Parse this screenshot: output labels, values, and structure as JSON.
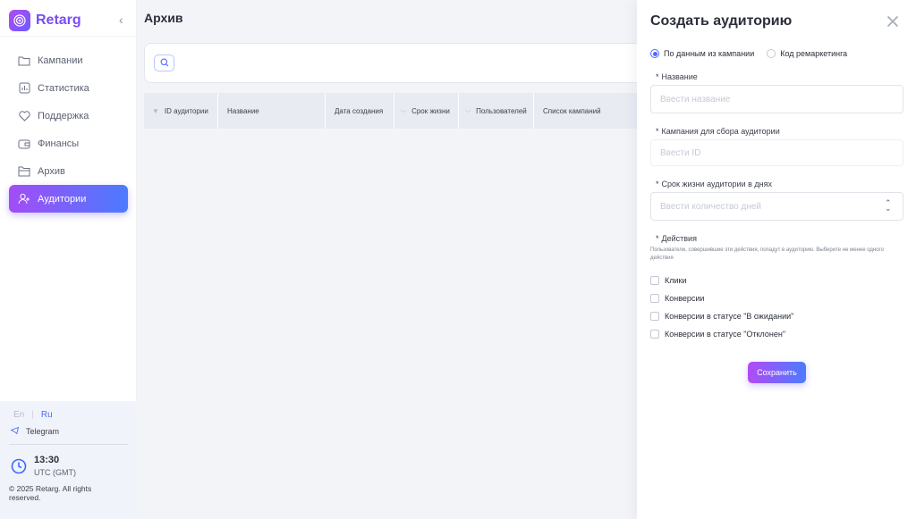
{
  "brand": {
    "name": "Retarg"
  },
  "sidebar": {
    "items": [
      {
        "label": "Кампании",
        "icon": "folder-icon"
      },
      {
        "label": "Статистика",
        "icon": "chart-icon"
      },
      {
        "label": "Поддержка",
        "icon": "heart-icon"
      },
      {
        "label": "Финансы",
        "icon": "wallet-icon"
      },
      {
        "label": "Архив",
        "icon": "archive-icon"
      },
      {
        "label": "Аудитории",
        "icon": "user-plus-icon",
        "active": true
      }
    ],
    "lang": {
      "en": "En",
      "separator": "|",
      "ru": "Ru",
      "active": "Ru"
    },
    "telegram": "Telegram",
    "clock": {
      "time": "13:30",
      "timezone": "UTC (GMT)"
    },
    "copyright": "© 2025 Retarg. All rights reserved."
  },
  "main": {
    "title": "Архив",
    "table": {
      "columns": [
        "ID аудитории",
        "Название",
        "Дата создания",
        "Срок жизни",
        "Пользователей",
        "Список кампаний"
      ]
    }
  },
  "drawer": {
    "title": "Создать аудиторию",
    "source_options": [
      {
        "label": "По данным из кампании",
        "selected": true
      },
      {
        "label": "Код ремаркетинга",
        "selected": false
      }
    ],
    "name": {
      "label": "Название",
      "required_mark": "*",
      "placeholder": "Ввести название"
    },
    "campaign": {
      "label": "Кампания для сбора аудитории",
      "required_mark": "*",
      "placeholder": "Ввести ID"
    },
    "lifetime": {
      "label": "Срок жизни аудитории в днях",
      "required_mark": "*",
      "placeholder": "Ввести количество дней"
    },
    "actions": {
      "label": "Действия",
      "required_mark": "*",
      "hint": "Пользователи, совершившие эти действия, попадут в аудиторию. Выберите не менее одного действия",
      "options": [
        "Клики",
        "Конверсии",
        "Конверсии в статусе \"В ожидании\"",
        "Конверсии в статусе \"Отклонен\""
      ]
    },
    "save_label": "Сохранить"
  },
  "colors": {
    "accent": "#4b6bff",
    "brand_gradient_start": "#b14bf4",
    "brand_gradient_end": "#4b7bff"
  }
}
